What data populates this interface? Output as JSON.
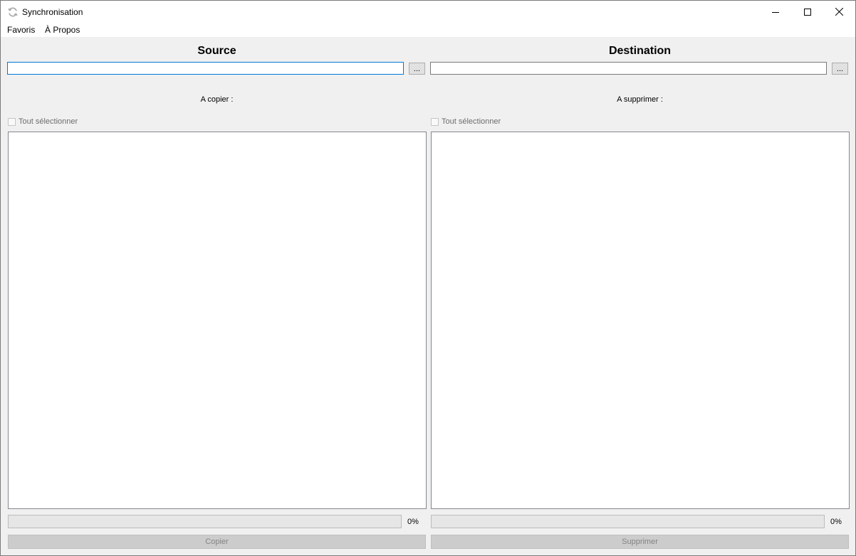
{
  "window": {
    "title": "Synchronisation",
    "icon": "sync-icon"
  },
  "menu": {
    "items": [
      "Favoris",
      "À Propos"
    ]
  },
  "source": {
    "title": "Source",
    "path_value": "",
    "browse_label": "...",
    "list_label": "A copier :",
    "select_all_label": "Tout sélectionner",
    "select_all_checked": false,
    "progress": 0,
    "progress_text": "0%",
    "action_label": "Copier"
  },
  "destination": {
    "title": "Destination",
    "path_value": "",
    "browse_label": "...",
    "list_label": "A supprimer :",
    "select_all_label": "Tout sélectionner",
    "select_all_checked": false,
    "progress": 0,
    "progress_text": "0%",
    "action_label": "Supprimer"
  },
  "colors": {
    "focus_border": "#0078d7",
    "progress_fill": "#06b025",
    "disabled_button": "#cccccc"
  }
}
